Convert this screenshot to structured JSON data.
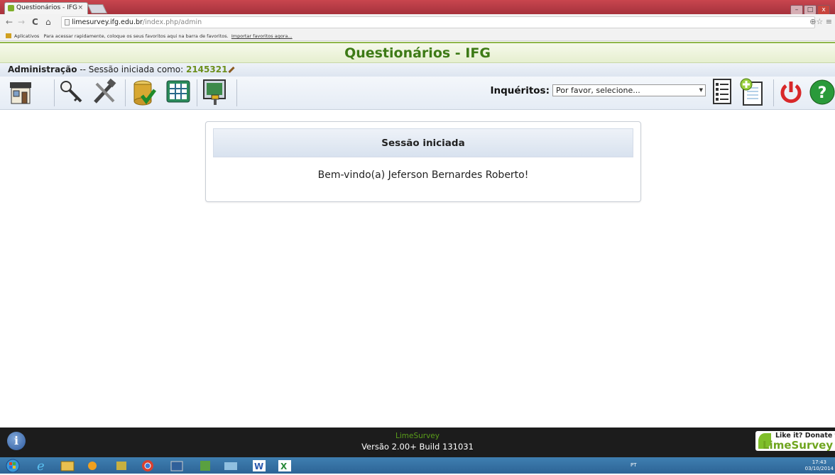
{
  "browser": {
    "tab_title": "Questionários - IFG",
    "tab_close": "×",
    "url_host": "limesurvey.ifg.edu.br",
    "url_path": "/index.php/admin",
    "bookmarks_apps": "Aplicativos",
    "bookmarks_hint": "Para acessar rapidamente, coloque os seus favoritos aqui na barra de favoritos.",
    "bookmarks_import": "Importar favoritos agora...",
    "back": "←",
    "forward": "→",
    "reload": "C",
    "home": "⌂",
    "zoom_star": "⊕☆",
    "menu": "≡"
  },
  "header": {
    "title": "Questionários - IFG"
  },
  "adminbar": {
    "label": "Administração",
    "separator": " -- Sessão iniciada como: ",
    "user_id": "2145321"
  },
  "toolbar": {
    "icons": [
      "home-icon",
      "key-icon",
      "tools-icon",
      "database-check-icon",
      "grid-icon",
      "screen-brush-icon",
      "survey-list-icon",
      "add-survey-icon",
      "logout-icon",
      "help-icon"
    ],
    "surveys_label": "Inquéritos:",
    "surveys_select_value": "Por favor, selecione...",
    "select_arrow": "▼"
  },
  "panel": {
    "heading": "Sessão iniciada",
    "message": "Bem-vindo(a) Jeferson Bernardes Roberto!"
  },
  "footer": {
    "info_icon": "i",
    "link_text": "LimeSurvey",
    "version": "Versão 2.00+ Build 131031",
    "donate_line1": "Like it? Donate to",
    "donate_line2": "LimeSurvey"
  },
  "taskbar": {
    "lang": "PT",
    "time": "17:43",
    "date": "03/10/2014"
  },
  "colors": {
    "brand_green": "#3d7a16",
    "footer_bg": "#1c1c1c",
    "taskbar": "#2d6496"
  }
}
